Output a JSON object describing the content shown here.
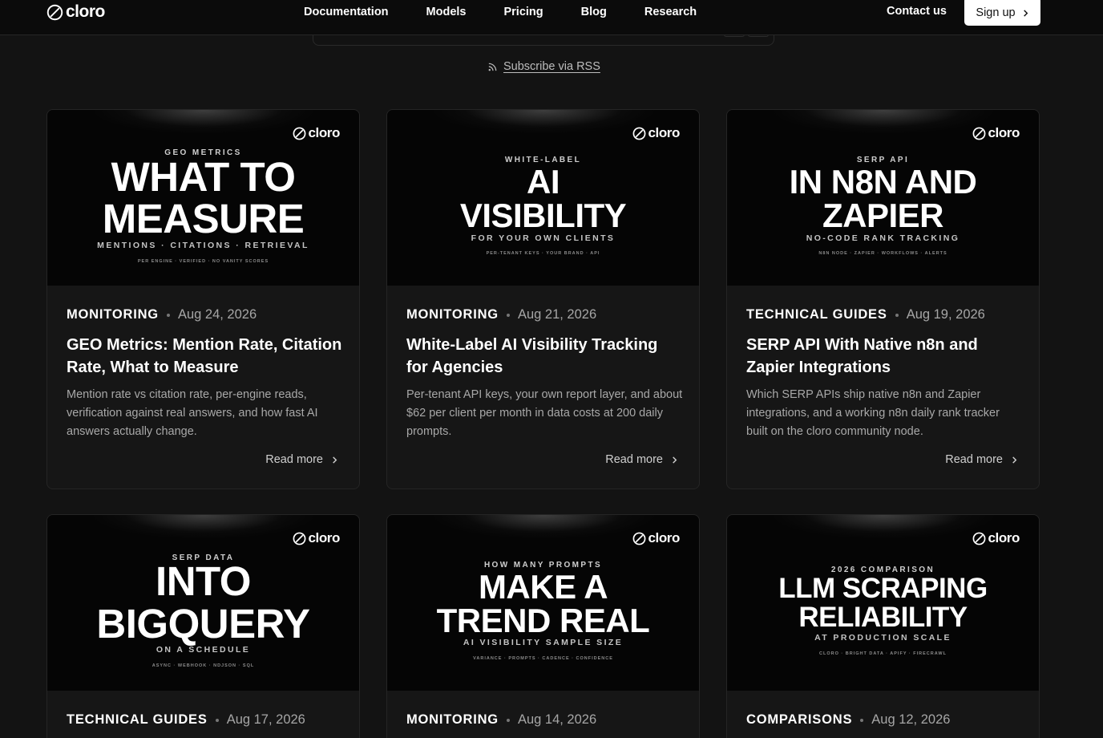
{
  "nav": {
    "brand": "cloro",
    "links": [
      "Documentation",
      "Models",
      "Pricing",
      "Blog",
      "Research"
    ],
    "contact": "Contact us",
    "signup": "Sign up"
  },
  "rss_label": "Subscribe via RSS",
  "cards": [
    {
      "cover": {
        "brand": "cloro",
        "kicker": "GEO METRICS",
        "headline": [
          "WHAT TO",
          "MEASURE"
        ],
        "subline": "MENTIONS · CITATIONS · RETRIEVAL",
        "tags": "PER ENGINE · VERIFIED · NO VANITY SCORES"
      },
      "category": "MONITORING",
      "date": "Aug 24, 2026",
      "title": "GEO Metrics: Mention Rate, Citation Rate, What to Measure",
      "description": "Mention rate vs citation rate, per-engine reads, verification against real answers, and how fast AI answers actually change.",
      "read_more": "Read more"
    },
    {
      "cover": {
        "brand": "cloro",
        "kicker": "WHITE-LABEL",
        "headline": [
          "AI",
          "VISIBILITY"
        ],
        "subline": "FOR YOUR OWN CLIENTS",
        "tags": "PER-TENANT KEYS · YOUR BRAND · API"
      },
      "category": "MONITORING",
      "date": "Aug 21, 2026",
      "title": "White-Label AI Visibility Tracking for Agencies",
      "description": "Per-tenant API keys, your own report layer, and about $62 per client per month in data costs at 200 daily prompts.",
      "read_more": "Read more"
    },
    {
      "cover": {
        "brand": "cloro",
        "kicker": "SERP API",
        "headline": [
          "IN N8N AND",
          "ZAPIER"
        ],
        "subline": "NO-CODE RANK TRACKING",
        "tags": "N8N NODE · ZAPIER · WORKFLOWS · ALERTS"
      },
      "category": "TECHNICAL GUIDES",
      "date": "Aug 19, 2026",
      "title": "SERP API With Native n8n and Zapier Integrations",
      "description": "Which SERP APIs ship native n8n and Zapier integrations, and a working n8n daily rank tracker built on the cloro community node.",
      "read_more": "Read more"
    },
    {
      "cover": {
        "brand": "cloro",
        "kicker": "SERP DATA",
        "headline": [
          "INTO",
          "BIGQUERY"
        ],
        "subline": "ON A SCHEDULE",
        "tags": "ASYNC · WEBHOOK · NDJSON · SQL"
      },
      "category": "TECHNICAL GUIDES",
      "date": "Aug 17, 2026"
    },
    {
      "cover": {
        "brand": "cloro",
        "kicker": "HOW MANY PROMPTS",
        "headline": [
          "MAKE A",
          "TREND REAL"
        ],
        "subline": "AI VISIBILITY SAMPLE SIZE",
        "tags": "VARIANCE · PROMPTS · CADENCE · CONFIDENCE"
      },
      "category": "MONITORING",
      "date": "Aug 14, 2026"
    },
    {
      "cover": {
        "brand": "cloro",
        "kicker": "2026 COMPARISON",
        "headline": [
          "LLM SCRAPING",
          "RELIABILITY"
        ],
        "subline": "AT PRODUCTION SCALE",
        "tags": "CLORO · BRIGHT DATA · APIFY · FIRECRAWL"
      },
      "category": "COMPARISONS",
      "date": "Aug 12, 2026"
    }
  ]
}
